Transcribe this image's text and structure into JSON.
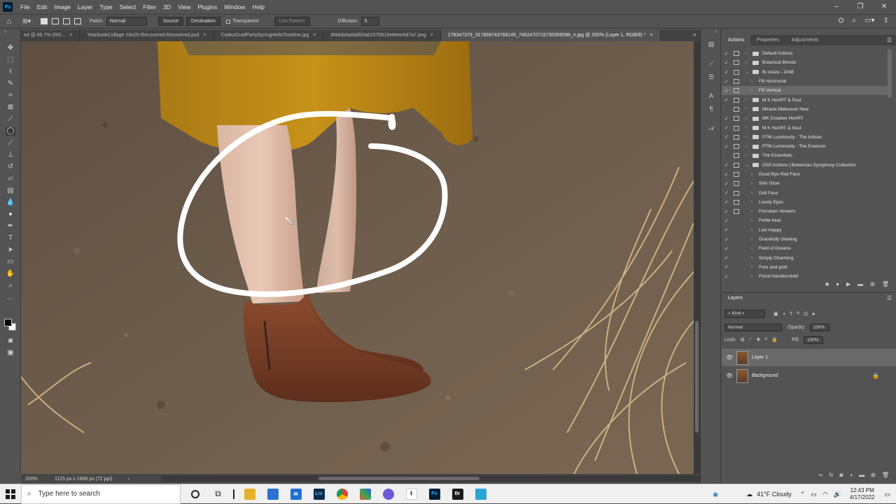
{
  "menu": [
    "File",
    "Edit",
    "Image",
    "Layer",
    "Type",
    "Select",
    "Filter",
    "3D",
    "View",
    "Plugins",
    "Window",
    "Help"
  ],
  "app_logo": "Ps",
  "options": {
    "patch_label": "Patch:",
    "patch_mode": "Normal",
    "source": "Source",
    "destination": "Destination",
    "transparent": "Transparent",
    "use_pattern": "Use Pattern",
    "diffusion_label": "Diffusion:",
    "diffusion_value": "5"
  },
  "tabs": [
    {
      "label": "ed @ 66.7% (RG...",
      "active": false
    },
    {
      "label": "YearbookCollage-16x20-Recovered-Recovered.psd",
      "active": false
    },
    {
      "label": "CadeyGradPartySpringHelloTimeline.jpg",
      "active": false
    },
    {
      "label": "8f44da3a6a6b3a81570816e8eee6d7a7.png",
      "active": false
    },
    {
      "label": "278347379_317859743768145_7452470715730356598_n.jpg @ 200% (Layer 1, RGB/8) *",
      "active": true
    }
  ],
  "status": {
    "zoom": "200%",
    "doc_info": "1125 px x 1688 px (72 ppi)"
  },
  "actions_panel": {
    "tabs": [
      "Actions",
      "Properties",
      "Adjustments"
    ],
    "items": [
      {
        "label": "Default Actions",
        "type": "set",
        "check": "✓",
        "dialog": true
      },
      {
        "label": "Botanical Blends",
        "type": "set",
        "check": "✓",
        "dialog": true
      },
      {
        "label": "fb resize - 2048",
        "type": "set-open",
        "check": "✓",
        "dialog": true
      },
      {
        "label": "FB Horizontal",
        "type": "action",
        "check": "✓",
        "dialog": true
      },
      {
        "label": "FB Vertical",
        "type": "action",
        "check": "✓",
        "dialog": true,
        "selected": true
      },
      {
        "label": "M K HeART & Soul",
        "type": "set",
        "check": "✓",
        "dialog": true
      },
      {
        "label": "Miracle Makeover New",
        "type": "set",
        "check": "",
        "dialog": true
      },
      {
        "label": "MK Creative HeART",
        "type": "set",
        "check": "✓",
        "dialog": true
      },
      {
        "label": "M K HeART & Soul",
        "type": "set",
        "check": "✓",
        "dialog": true
      },
      {
        "label": "PTM Luminosity - The Artisan",
        "type": "set",
        "check": "✓",
        "dialog": true
      },
      {
        "label": "PTM Luminosity - The Essence",
        "type": "set",
        "check": "✓",
        "dialog": true
      },
      {
        "label": "The Essentials",
        "type": "set",
        "check": "",
        "dialog": true
      },
      {
        "label": "OSP Actions | Bohemian Symphony Collection",
        "type": "set-open",
        "check": "✓",
        "dialog": true
      },
      {
        "label": "Good Bye Red Face",
        "type": "action",
        "check": "✓",
        "dialog": true
      },
      {
        "label": "Skin Glow",
        "type": "action",
        "check": "✓",
        "dialog": true
      },
      {
        "label": "Doll Face",
        "type": "action",
        "check": "✓",
        "dialog": true
      },
      {
        "label": "Lovely Eyes",
        "type": "action",
        "check": "✓",
        "dialog": true
      },
      {
        "label": "Porcelain Veneers",
        "type": "action",
        "check": "✓",
        "dialog": true
      },
      {
        "label": "Petite treat",
        "type": "action",
        "check": "✓",
        "dialog": false
      },
      {
        "label": "Live Happy",
        "type": "action",
        "check": "✓",
        "dialog": false
      },
      {
        "label": "Gracefully Glowing",
        "type": "action",
        "check": "✓",
        "dialog": false
      },
      {
        "label": "Field of Dreams",
        "type": "action",
        "check": "✓",
        "dialog": false
      },
      {
        "label": "Simply Charming",
        "type": "action",
        "check": "✓",
        "dialog": false
      },
      {
        "label": "Pure and gold",
        "type": "action",
        "check": "✓",
        "dialog": false
      },
      {
        "label": "Floral Handkerchief",
        "type": "action",
        "check": "✓",
        "dialog": false
      }
    ]
  },
  "layers_panel": {
    "title": "Layers",
    "kind": "Kind",
    "blend_mode": "Normal",
    "opacity_label": "Opacity:",
    "opacity_value": "100%",
    "lock_label": "Lock:",
    "fill_label": "Fill:",
    "fill_value": "100%",
    "layers": [
      {
        "name": "Layer 1",
        "selected": true,
        "locked": false
      },
      {
        "name": "Background",
        "selected": false,
        "locked": true
      }
    ]
  },
  "taskbar": {
    "search_placeholder": "Type here to search",
    "weather": "41°F  Cloudy",
    "time": "12:43 PM",
    "date": "4/17/2022"
  },
  "colors": {
    "ps_bg": "#535353",
    "panel_dark": "#424242",
    "selected": "#696969",
    "accent_blue": "#31a8ff"
  }
}
